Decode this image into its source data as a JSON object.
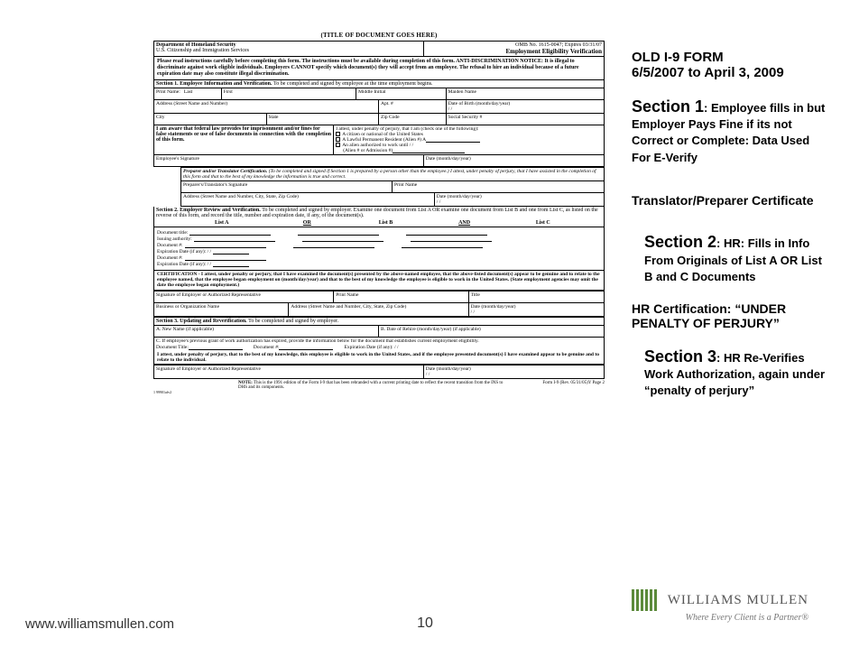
{
  "form": {
    "title": "(TITLE OF DOCUMENT GOES HERE)",
    "dept1": "Department of Homeland Security",
    "dept2": "U.S. Citizenship and Immigration Services",
    "omb": "OMB No. 1615-0047; Expires 03/31/07",
    "form_name": "Employment Eligibility Verification",
    "notice": "Please read instructions carefully before completing this form. The instructions must be available during completion of this form. ANTI-DISCRIMINATION NOTICE: It is illegal to discriminate against work eligible individuals. Employers CANNOT specify which document(s) they will accept from an employee. The refusal to hire an individual because of a future expiration date may also constitute illegal discrimination.",
    "sec1_title": "Section 1. Employee Information and Verification.",
    "sec1_sub": "To be completed and signed by employee at the time employment begins.",
    "print_name": "Print Name:",
    "last": "Last",
    "first": "First",
    "mi": "Middle Initial",
    "maiden": "Maiden Name",
    "address": "Address (Street Name and Number)",
    "apt": "Apt. #",
    "dob": "Date of Birth (month/day/year)",
    "dob_slash": "/       /",
    "city": "City",
    "state": "State",
    "zip": "Zip Code",
    "ssn": "Social Security #",
    "aware": "I am aware that federal law provides for imprisonment and/or fines for false statements or use of false documents in connection with the completion of this form.",
    "attest": "I attest, under penalty of perjury, that I am (check one of the following):",
    "opt1": "A citizen or national of the United States",
    "opt2": "A Lawful Permanent Resident (Alien #) A",
    "opt3": "An alien authorized to work until       /       /",
    "opt4": "(Alien # or Admission #)",
    "emp_sig": "Employee's Signature",
    "date": "Date (month/day/year)",
    "preparer_title": "Preparer and/or Translator Certification.",
    "preparer_body": "(To be completed and signed if Section 1 is prepared by a person other than the employee.) I attest, under penalty of perjury, that I have assisted in the completion of this form and that to the best of my knowledge the information is true and correct.",
    "prep_sig": "Preparer's/Translator's Signature",
    "prep_name": "Print Name",
    "prep_addr": "Address (Street Name and Number, City, State, Zip Code)",
    "sec2_title": "Section 2. Employer Review and Verification.",
    "sec2_body": "To be completed and signed by employer. Examine one document from List A OR examine one document from List B and one from List C, as listed on the reverse of this form, and record the title, number and expiration date, if any, of the document(s).",
    "listA": "List A",
    "or": "OR",
    "listB": "List B",
    "and": "AND",
    "listC": "List C",
    "doc_title": "Document title:",
    "issuing": "Issuing authority:",
    "docnum": "Document #:",
    "expdate": "Expiration Date (if any):       /       /",
    "cert": "CERTIFICATION - I attest, under penalty or perjury, that I have examined the document(s) presented by the above-named employee, that the above-listed document(s) appear to be genuine and to relate to the employee named, that the employee began employment on (month/day/year)                and that to the best of my knowledge the employee is eligible to work in the United States. (State employment agencies may omit the date the employee began employment.)",
    "sig_emp": "Signature of Employer or Authorized Representative",
    "print_name2": "Print Name",
    "title_f": "Title",
    "bus_name": "Business or Organization Name",
    "bus_addr": "Address (Street Name and Number, City, State, Zip Code)",
    "sec3_title": "Section 3. Updating and Reverification.",
    "sec3_sub": "To be completed and signed by employer.",
    "newname": "A. New Name (if applicable)",
    "rehire": "B. Date of Rehire (month/day/year) (if applicable)",
    "c_line": "C. If employee's previous grant of work authorization has expired, provide the information below for the document that establishes current employment eligibility.",
    "doc_title2": "Document Title:",
    "docnum2": "Document #:",
    "expdate2": "Expiration Date (if any):       /       /",
    "sec3_attest": "I attest, under penalty of perjury, that to the best of my knowledge, this employee is eligible to work in the United States, and if the employee presented document(s) I have examined appear to be genuine and to relate to the individual.",
    "sig_auth": "Signature of Employer or Authorized Representative",
    "note_label": "NOTE:",
    "note_body": "This is the 1991 edition of the Form I-9 that has been rebranded with a current printing date to reflect the recent transition from the INS to DHS and its components.",
    "form_rev": "Form I-9 (Rev. 05/31/05)Y Page 2",
    "bottom_num": "1 99901afv2"
  },
  "ann": {
    "old1": "OLD I-9 FORM",
    "old2": "6/5/2007 to April 3, 2009",
    "s1_big": "Section 1",
    "s1_rest": ": Employee fills in but Employer Pays Fine if its not Correct or Complete: Data Used For E-Verify",
    "translator": "Translator/Preparer Certificate",
    "s2_big": "Section 2",
    "s2_rest": ": HR: Fills in Info From Originals of List A  OR List B and C Documents",
    "hr_cert": "HR Certification: “UNDER PENALTY OF PERJURY”",
    "s3_big": "Section 3",
    "s3_rest": ": HR Re-Verifies Work Authorization, again under “penalty of perjury”"
  },
  "logo": {
    "name": "WILLIAMS MULLEN",
    "tag": "Where Every Client is a Partner®"
  },
  "footer": {
    "url": "www.williamsmullen.com"
  },
  "page": "10"
}
